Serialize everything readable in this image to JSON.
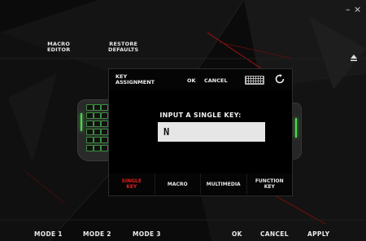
{
  "window": {
    "minimize_label": "–",
    "close_label": "×"
  },
  "topbar": {
    "macro_editor_line1": "MACRO",
    "macro_editor_line2": "EDITOR",
    "restore_defaults_line1": "RESTORE",
    "restore_defaults_line2": "DEFAULTS"
  },
  "dialog": {
    "title_line1": "KEY",
    "title_line2": "ASSIGNMENT",
    "ok_label": "OK",
    "cancel_label": "CANCEL",
    "prompt": "INPUT A SINGLE KEY:",
    "key_value": "N",
    "tabs": [
      {
        "line1": "SINGLE",
        "line2": "KEY"
      },
      {
        "line1": "MACRO",
        "line2": ""
      },
      {
        "line1": "MULTIMEDIA",
        "line2": ""
      },
      {
        "line1": "FUNCTION",
        "line2": "KEY"
      }
    ],
    "active_tab_color": "#e02020"
  },
  "bottombar": {
    "mode1": "MODE 1",
    "mode2": "MODE 2",
    "mode3": "MODE 3",
    "ok": "OK",
    "cancel": "CANCEL",
    "apply": "APPLY"
  },
  "icons": {
    "eject": "eject-icon",
    "keyboard": "keyboard-icon",
    "refresh": "refresh-icon"
  },
  "colors": {
    "accent": "#e02020",
    "glow": "#4cd84c",
    "background": "#0c0c0c"
  }
}
